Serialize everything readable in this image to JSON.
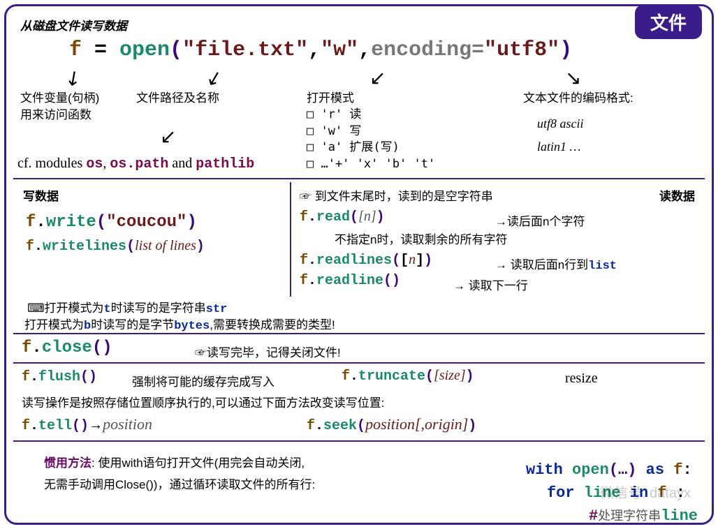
{
  "badge": "文件",
  "header_note": "从磁盘文件读写数据",
  "codeline": {
    "f": "f",
    "eq": " = ",
    "open": "open",
    "lp": "(",
    "s1": "\"file.txt\"",
    "c1": ",",
    "s2": "\"w\"",
    "c2": ",",
    "enc": "encoding=",
    "s3": "\"utf8\"",
    "rp": ")"
  },
  "anno": {
    "handle1": "文件变量(句柄)",
    "handle2": "用来访问函数",
    "path": "文件路径及名称",
    "mode_title": "打开模式",
    "mode_r": "□ 'r' 读",
    "mode_w": "□ 'w' 写",
    "mode_a": "□ 'a' 扩展(写)",
    "mode_plus": "□ …'+' 'x' 'b' 't'",
    "enc_title": "文本文件的编码格式:",
    "enc1": "utf8  ascii",
    "enc2": "latin1  …"
  },
  "modules": {
    "pre": "cf. modules ",
    "os": "os",
    "c1": ",  ",
    "ospath": "os.path",
    "and": " and ",
    "pathlib": "pathlib"
  },
  "write": {
    "title": "写数据",
    "write": "write",
    "wstr": "\"coucou\"",
    "writelines": "writelines",
    "wlarr": "list of lines"
  },
  "read": {
    "title": "读数据",
    "eof": "☞ 到文件末尾时，读到的是空字符串",
    "read": "read",
    "rn": "[n]",
    "rn_desc": "→读后面n个字符",
    "rn_desc2": "不指定n时，读取剩余的所有字符",
    "readlines": "readlines",
    "rl_n": "n",
    "rl_desc": "→  读取后面n行到",
    "rl_list": "list",
    "readline": "readline",
    "rline_desc": "→  读取下一行"
  },
  "tnote1a": "⌨打开模式为",
  "tnote1b": "t",
  "tnote1c": "时读写的是字符串",
  "tnote1d": "str",
  "tnote2a": "打开模式为",
  "tnote2b": "b",
  "tnote2c": "时读写的是字节",
  "tnote2d": "bytes",
  "tnote2e": ",需要转换成需要的类型!",
  "close": {
    "method": "close",
    "note": "☞读写完毕，记得关闭文件!"
  },
  "flush": {
    "method": "flush",
    "desc": "强制将可能的缓存完成写入"
  },
  "truncate": {
    "method": "truncate",
    "arg": "[size]",
    "desc": "resize"
  },
  "seeknote": "读写操作是按照存储位置顺序执行的,可以通过下面方法改变读写位置:",
  "tell": {
    "method": "tell",
    "ret": "position"
  },
  "seek": {
    "method": "seek",
    "arg": "position[,origin]"
  },
  "idiom": {
    "label": "惯用方法",
    "text1": ":   使用with语句打开文件(用完会自动关闭,",
    "text2": "无需手动调用Close())，通过循环读取文件的所有行:"
  },
  "withblock": {
    "l1a": "with",
    "l1b": " open",
    "l1c": "(…)",
    "l1d": " as ",
    "l1e": "f",
    "l1f": ":",
    "l2a": "for ",
    "l2b": "line",
    "l2c": " in ",
    "l2d": "f ",
    "l2e": ":",
    "l3a": "#",
    "l3b": "处理字符串",
    "l3c": "line"
  },
  "watermark": "微信号: datayx"
}
